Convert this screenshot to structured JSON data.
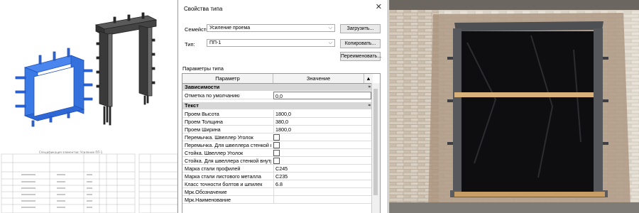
{
  "dialog": {
    "title": "Свойства типа",
    "family_label": "Семейство:",
    "family_value": "Усиление проема",
    "type_label": "Тип:",
    "type_value": "ПП-1",
    "load_button": "Загрузить...",
    "copy_button": "Копировать...",
    "rename_button": "Переименовать...",
    "params_caption": "Параметры типа",
    "col_param": "Параметр",
    "col_value": "Значение",
    "close_glyph": "✕",
    "close_icon": "close-icon"
  },
  "groups": {
    "dependencies": "Зависимости",
    "text": "Текст",
    "collapse_glyph": "≈"
  },
  "rows": [
    {
      "param": "Отметка по умолчанию",
      "value": "0,0"
    },
    {
      "param": "Проем Высота",
      "value": "1800,0"
    },
    {
      "param": "Проем Толщина",
      "value": "380,0"
    },
    {
      "param": "Проем Ширина",
      "value": "1800,0"
    },
    {
      "param": "Перемычка. Швеллер Уголок",
      "value": ""
    },
    {
      "param": "Перемычка. Для швеллера стенкой наружу",
      "value": ""
    },
    {
      "param": "Стойка. Швеллер Уголок",
      "value": ""
    },
    {
      "param": "Стойка. Для швеллера стенкой внутрь",
      "value": ""
    },
    {
      "param": "Марка стали профилей",
      "value": "С245"
    },
    {
      "param": "Марка стали листового металла",
      "value": "С235"
    },
    {
      "param": "Класс точности болтов и шпилек",
      "value": "6.8"
    },
    {
      "param": "Мрк.Обозначение",
      "value": ""
    },
    {
      "param": "Мрк.Наименование",
      "value": ""
    }
  ],
  "schedule": {
    "title": "Спецификация элементов: Усиление ПП-1"
  },
  "colors": {
    "cad_blue": "#2f6fe0",
    "steel_dark": "#3c3c3c",
    "group_gray": "#d7d7d7"
  }
}
